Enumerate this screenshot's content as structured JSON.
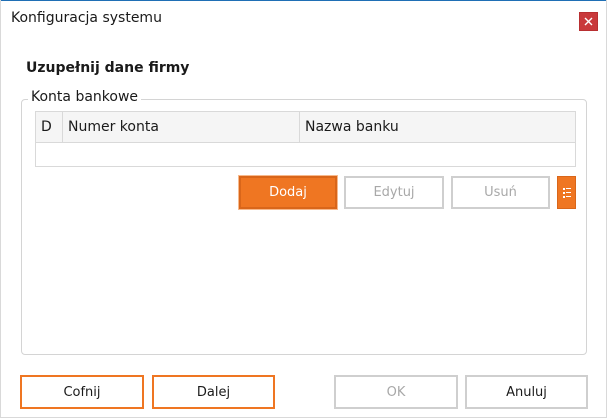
{
  "window": {
    "title": "Konfiguracja systemu"
  },
  "heading": "Uzupełnij dane firmy",
  "bank_accounts": {
    "legend": "Konta bankowe",
    "columns": [
      "D",
      "Numer konta",
      "Nazwa banku"
    ],
    "rows": []
  },
  "grid_actions": {
    "add_label": "Dodaj",
    "edit_label": "Edytuj",
    "delete_label": "Usuń",
    "menu_icon": "list-icon"
  },
  "footer": {
    "back_label": "Cofnij",
    "next_label": "Dalej",
    "ok_label": "OK",
    "cancel_label": "Anuluj"
  },
  "colors": {
    "accent": "#ef7622",
    "close": "#c9393b",
    "disabled_text": "#a8a8a8"
  }
}
